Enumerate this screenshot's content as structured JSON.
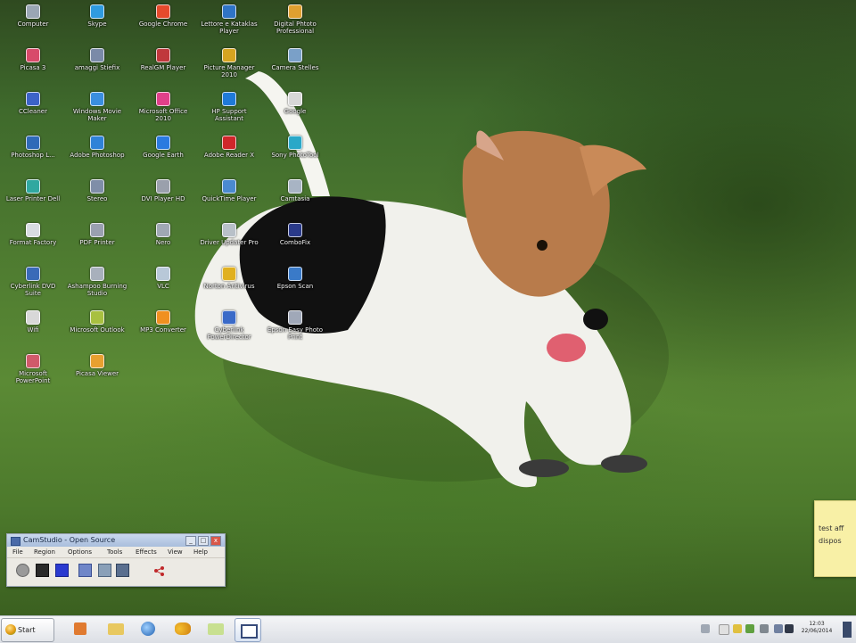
{
  "desktop": {
    "icons": [
      {
        "label": "Computer",
        "color": "#9aa6b4"
      },
      {
        "label": "Skype",
        "color": "#2f9be0"
      },
      {
        "label": "Google Chrome",
        "color": "#e54a2c"
      },
      {
        "label": "Lettore e Kataklas Player",
        "color": "#2f74c6"
      },
      {
        "label": "Digital Phtoto Professional",
        "color": "#e0a030"
      },
      {
        "label": "Picasa 3",
        "color": "#d84a6a"
      },
      {
        "label": "amaggi Stiefix",
        "color": "#7a8aa8"
      },
      {
        "label": "RealGM Player",
        "color": "#c0383c"
      },
      {
        "label": "Picture Manager 2010",
        "color": "#d6a420"
      },
      {
        "label": "Camera Stelles",
        "color": "#7aa0c8"
      },
      {
        "label": "CCleaner",
        "color": "#3c63c8"
      },
      {
        "label": "Windows Movie Maker",
        "color": "#3a8ee0"
      },
      {
        "label": "Microsoft Office 2010",
        "color": "#e0408a"
      },
      {
        "label": "HP Support Assistant",
        "color": "#1f7ad8"
      },
      {
        "label": "Google",
        "color": "#d8d8d8"
      },
      {
        "label": "Photoshop L...",
        "color": "#2f6ab8"
      },
      {
        "label": "Adobe Photoshop",
        "color": "#2f82d8"
      },
      {
        "label": "Google Earth",
        "color": "#2a7ae0"
      },
      {
        "label": "Adobe Reader X",
        "color": "#d0262a"
      },
      {
        "label": "Sony PhotoTool",
        "color": "#2aa8c8"
      },
      {
        "label": "Laser Printer Dell",
        "color": "#30a8a0"
      },
      {
        "label": "Stereo",
        "color": "#7f8ea8"
      },
      {
        "label": "DVI Player HD",
        "color": "#9aa0ac"
      },
      {
        "label": "QuickTime Player",
        "color": "#4a8ad0"
      },
      {
        "label": "Camtasia",
        "color": "#a8b4c4"
      },
      {
        "label": "Format Factory",
        "color": "#d8dce2"
      },
      {
        "label": "PDF Printer",
        "color": "#9aa0b0"
      },
      {
        "label": "Nero",
        "color": "#a0a8b4"
      },
      {
        "label": "Driver Updater Pro",
        "color": "#b8c0c8"
      },
      {
        "label": "ComboFix",
        "color": "#2a3a8a"
      },
      {
        "label": "Cyberlink DVD Suite",
        "color": "#3a6ab8"
      },
      {
        "label": "Ashampoo Burning Studio",
        "color": "#a8b0bc"
      },
      {
        "label": "VLC",
        "color": "#b8c8d8"
      },
      {
        "label": "Norton Antivirus",
        "color": "#e0b020"
      },
      {
        "label": "Epson Scan",
        "color": "#3a7ac8"
      },
      {
        "label": "Wifi",
        "color": "#d8d8d8"
      },
      {
        "label": "Microsoft Outlook",
        "color": "#a8c040"
      },
      {
        "label": "MP3 Converter",
        "color": "#f09020"
      },
      {
        "label": "Cyberlink PowerDirector",
        "color": "#3a6ac8"
      },
      {
        "label": "Epson Easy Photo Print",
        "color": "#a0a8b8"
      },
      {
        "label": "Microsoft PowerPoint",
        "color": "#d05a6a"
      },
      {
        "label": "Picasa Viewer",
        "color": "#e8a030"
      }
    ]
  },
  "sticky_note": {
    "line1": "test aff",
    "line2": "dispos"
  },
  "camstudio": {
    "title": "CamStudio - Open Source",
    "menu": [
      "File",
      "Region",
      "Options",
      "Tools",
      "Effects",
      "View",
      "Help"
    ],
    "window_controls": {
      "minimize": "_",
      "maximize": "□",
      "close": "x"
    }
  },
  "taskbar": {
    "start_label": "Start",
    "clock_time": "12:03",
    "clock_date": "22/06/2014"
  }
}
